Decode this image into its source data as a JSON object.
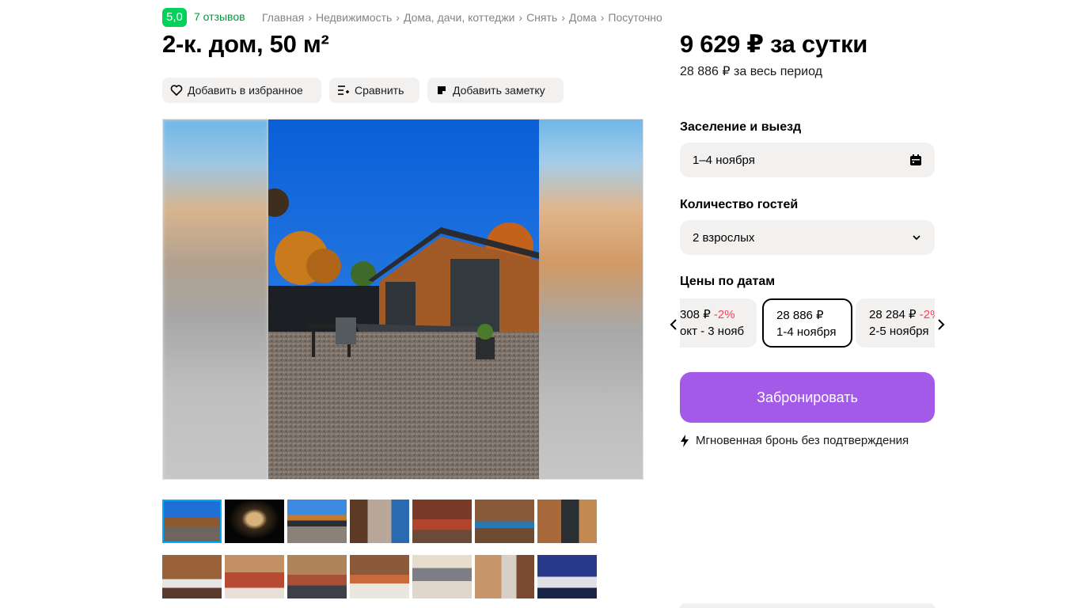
{
  "header": {
    "rating": "5,0",
    "reviews": "7 отзывов",
    "breadcrumbs": [
      "Главная",
      "Недвижимость",
      "Дома, дачи, коттеджи",
      "Снять",
      "Дома",
      "Посуточно"
    ],
    "title": "2-к. дом, 50 м²"
  },
  "actions": {
    "favorite": "Добавить в избранное",
    "compare": "Сравнить",
    "note": "Добавить заметку"
  },
  "booking": {
    "price": "9 629 ₽ за сутки",
    "period_price": "28 886 ₽ за весь период",
    "checkin_label": "Заселение и выезд",
    "checkin_value": "1–4 ноября",
    "guests_label": "Количество гостей",
    "guests_value": "2 взрослых",
    "dates_label": "Цены по датам",
    "date_cards": [
      {
        "price": "308 ₽",
        "discount": "-2%",
        "dates": "окт - 3 нояб"
      },
      {
        "price": "28 886 ₽",
        "discount": "",
        "dates": "1-4 ноября"
      },
      {
        "price": "28 284 ₽",
        "discount": "-2%",
        "dates": "2-5 ноября"
      }
    ],
    "book_button": "Забронировать",
    "instant_text": "Мгновенная бронь без подтверждения"
  },
  "icons": {
    "favorite": "heart-icon",
    "compare": "compare-list-icon",
    "note": "note-icon",
    "calendar": "calendar-icon",
    "dropdown": "chevron-down-icon",
    "prev": "chevron-left-icon",
    "next": "chevron-right-icon",
    "instant": "lightning-icon"
  },
  "colors": {
    "accent": "#a35ae9",
    "rating": "#02d15c",
    "reviews": "#009a3a",
    "discount": "#ff4053"
  }
}
